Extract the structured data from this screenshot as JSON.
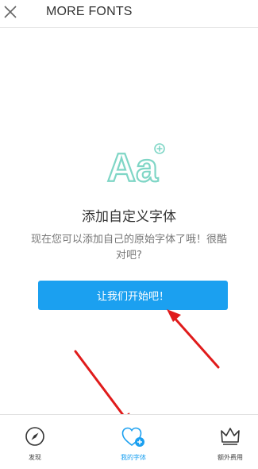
{
  "header": {
    "title": "MORE FONTS"
  },
  "empty_state": {
    "logo_text": "Aa",
    "heading": "添加自定义字体",
    "description": "现在您可以添加自己的原始字体了哦！很酷对吧?",
    "cta_label": "让我们开始吧！"
  },
  "tabs": [
    {
      "label": "发现",
      "icon": "compass-icon",
      "active": false
    },
    {
      "label": "我的字体",
      "icon": "heart-plus-icon",
      "active": true
    },
    {
      "label": "额外费用",
      "icon": "crown-icon",
      "active": false
    }
  ],
  "colors": {
    "accent": "#1ba0f0",
    "annotation_arrow": "#e01b1b",
    "logo_teal": "#7fd6c6"
  }
}
